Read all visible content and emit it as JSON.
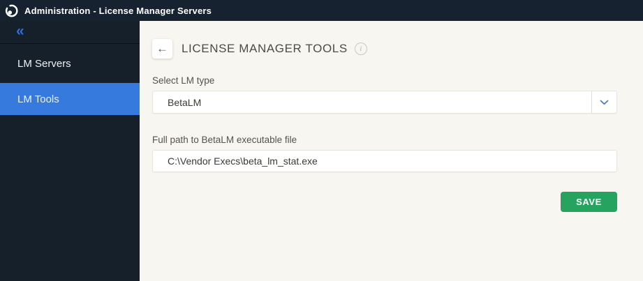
{
  "titlebar": {
    "title": "Administration - License Manager Servers"
  },
  "sidebar": {
    "items": [
      {
        "label": "LM Servers",
        "selected": false
      },
      {
        "label": "LM Tools",
        "selected": true
      }
    ]
  },
  "main": {
    "heading": "LICENSE MANAGER TOOLS",
    "fields": [
      {
        "label": "Select LM type",
        "type": "select",
        "value": "BetaLM"
      },
      {
        "label": "Full path to BetaLM executable file",
        "type": "text",
        "value": "C:\\Vendor Execs\\beta_lm_stat.exe"
      }
    ],
    "save_label": "SAVE"
  },
  "icons": {
    "collapse": "«",
    "back": "←",
    "info": "i"
  },
  "colors": {
    "topbar_bg": "#16222f",
    "sidebar_bg": "#15202b",
    "selected_item_bg": "#377ade",
    "accent_blue": "#2f6fd6",
    "save_green": "#27a360",
    "content_bg": "#f8f6f1"
  }
}
